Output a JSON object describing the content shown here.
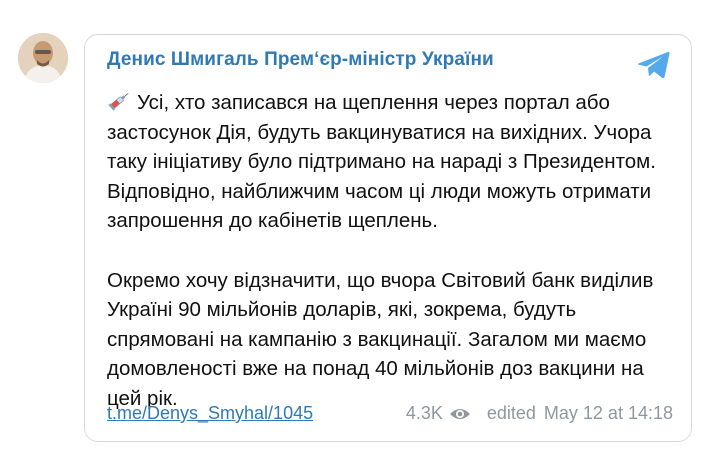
{
  "post": {
    "author": "Денис Шмигаль Прем‘єр-міністр України",
    "paragraphs": [
      "Усі, хто записався на щеплення через портал або застосунок Дія, будуть вакцинуватися на вихідних. Учора таку ініціативу було підтримано на нараді з Президентом. Відповідно, найближчим часом ці люди можуть отримати запрошення до кабінетів щеплень.",
      "Окремо хочу відзначити, що вчора Світовий банк виділив Україні 90 мільйонів доларів, які, зокрема, будуть спрямовані на кампанію з вакцинації. Загалом ми маємо домовленості вже на понад 40 мільйонів доз вакцини на цей рік."
    ],
    "link": "t.me/Denys_Smyhal/1045",
    "views": "4.3K",
    "edited_label": "edited",
    "date": "May 12 at 14:18"
  },
  "icons": {
    "avatar": "author-photo",
    "emoji": "syringe-icon",
    "brand": "telegram-icon",
    "views": "eye-icon"
  },
  "colors": {
    "accent": "#2f79b5",
    "muted": "#8f98a1",
    "telegram": "#54a9eb"
  }
}
